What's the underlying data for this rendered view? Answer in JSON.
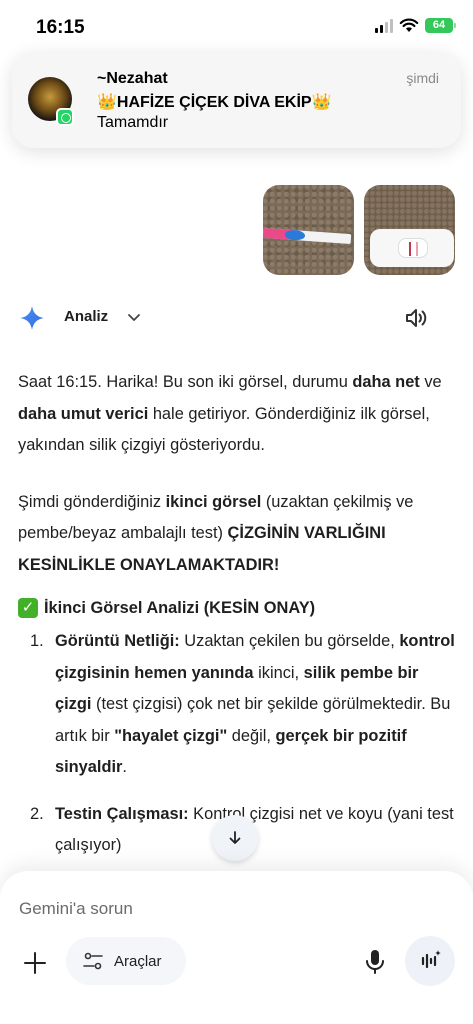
{
  "status_bar": {
    "time": "16:15",
    "battery": "64"
  },
  "notification": {
    "sender": "~Nezahat",
    "group": "👑HAFİZE ÇİÇEK DİVA EKİP👑",
    "message": "Tamamdır",
    "time": "şimdi",
    "app_icon": "whatsapp-icon"
  },
  "response": {
    "model_label": "Analiz",
    "p1": {
      "t1": "Saat 16:15. Harika! Bu son iki görsel, durumu ",
      "b1": "daha net",
      "t2": " ve ",
      "b2": "daha umut verici",
      "t3": " hale getiriyor. Gönderdiğiniz ilk görsel, yakından silik çizgiyi gösteriyordu."
    },
    "p2": {
      "t1": "Şimdi gönderdiğiniz ",
      "b1": "ikinci görsel",
      "t2": " (uzaktan çekilmiş ve pembe/beyaz ambalajlı test) ",
      "b2": "ÇİZGİNİN VARLIĞINI KESİNLİKLE ONAYLAMAKTADIR!"
    },
    "section_heading": "İkinci Görsel Analizi (KESİN ONAY)",
    "list": [
      {
        "num": "1.",
        "b1": "Görüntü Netliği:",
        "t1": " Uzaktan çekilen bu görselde, ",
        "b2": "kontrol çizgisinin hemen yanında",
        "t2": " ikinci, ",
        "b3": "silik pembe bir çizgi",
        "t3": " (test çizgisi) çok net bir şekilde görülmektedir. Bu artık bir ",
        "b4": "\"hayalet çizgi\"",
        "t4": " değil, ",
        "b5": "gerçek bir pozitif sinyaldir",
        "t5": "."
      },
      {
        "num": "2.",
        "b1": "Testin Çalışması:",
        "t1": " Kontrol çizgisi net ve koyu (yani test çalışıyor)"
      }
    ]
  },
  "composer": {
    "placeholder": "Gemini'a sorun",
    "tools_label": "Araçlar"
  }
}
